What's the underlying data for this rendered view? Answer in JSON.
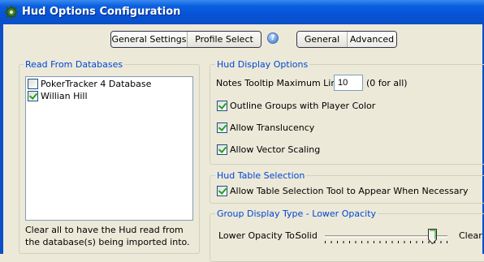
{
  "window": {
    "title": "Hud Options Configuration"
  },
  "icons": {
    "app": "gear-icon",
    "help": "help-icon"
  },
  "colors": {
    "titlebar": "#0753d6",
    "group_legend": "#0046d5",
    "check": "#21a121"
  },
  "tabs_left": [
    {
      "label": "General Settings",
      "active": false
    },
    {
      "label": "Profile Select",
      "active": true
    }
  ],
  "tabs_right": [
    {
      "label": "General",
      "active": true
    },
    {
      "label": "Advanced",
      "active": false
    }
  ],
  "databases": {
    "legend": "Read From Databases",
    "items": [
      {
        "label": "PokerTracker 4 Database",
        "checked": false
      },
      {
        "label": "Willian Hill",
        "checked": true
      }
    ],
    "note_line1": "Clear all to have the Hud read from",
    "note_line2": "the database(s) being imported into."
  },
  "hud_display": {
    "legend": "Hud Display Options",
    "notes_label": "Notes Tooltip Maximum Lines:",
    "notes_value": "10",
    "notes_hint": "(0 for all)",
    "outline_label": "Outline Groups with Player Color",
    "outline_checked": true,
    "translucency_label": "Allow Translucency",
    "translucency_checked": true,
    "vector_label": "Allow Vector Scaling",
    "vector_checked": true
  },
  "table_selection": {
    "legend": "Hud Table Selection",
    "allow_label": "Allow Table Selection Tool to Appear When Necessary",
    "allow_checked": true
  },
  "group_display": {
    "legend": "Group Display Type - Lower Opacity",
    "lower_label": "Lower Opacity To:",
    "min_label": "Solid",
    "max_label": "Clear",
    "slider_fraction": 0.88
  }
}
